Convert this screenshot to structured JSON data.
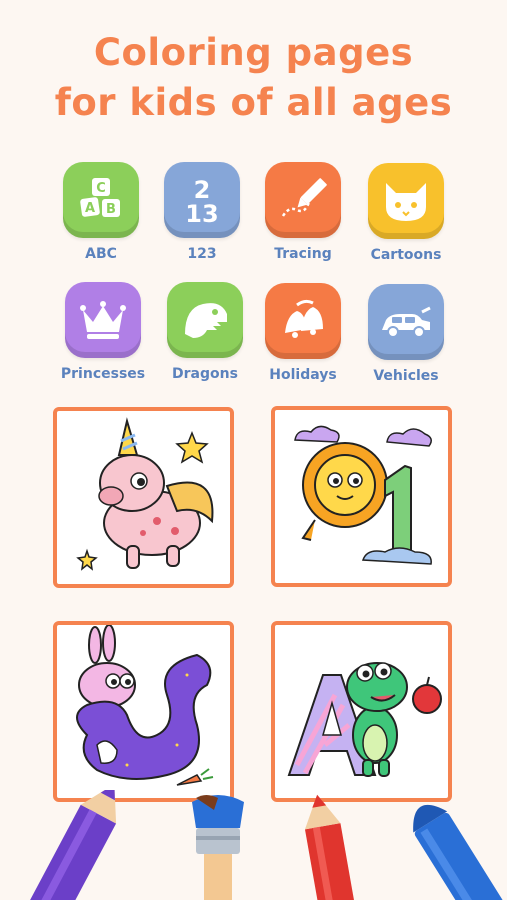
{
  "header": {
    "title_line1": "Coloring pages",
    "title_line2": "for kids of all ages"
  },
  "categories": [
    {
      "label": "ABC",
      "icon": "abc-blocks-icon",
      "color": "#8ccf5a"
    },
    {
      "label": "123",
      "icon": "numbers-icon",
      "color": "#86a6d8"
    },
    {
      "label": "Tracing",
      "icon": "pencil-icon",
      "color": "#f57a45"
    },
    {
      "label": "Cartoons",
      "icon": "cat-face-icon",
      "color": "#f8c12c"
    },
    {
      "label": "Princesses",
      "icon": "crown-icon",
      "color": "#b07fe6"
    },
    {
      "label": "Dragons",
      "icon": "dinosaur-icon",
      "color": "#8ccf5a"
    },
    {
      "label": "Holidays",
      "icon": "bells-icon",
      "color": "#f57a45"
    },
    {
      "label": "Vehicles",
      "icon": "car-icon",
      "color": "#86a6d8"
    }
  ],
  "pages": [
    {
      "name": "unicorn-coloring-page"
    },
    {
      "name": "sun-number-one-page"
    },
    {
      "name": "bunny-maze-page"
    },
    {
      "name": "dragon-letter-a-page"
    }
  ],
  "decor": {
    "crayons": [
      "purple-pencil",
      "paint-brush",
      "red-pencil",
      "blue-crayon"
    ]
  },
  "colors": {
    "accent": "#f5834f",
    "label": "#5b82bd",
    "background": "#fdf7f2"
  }
}
